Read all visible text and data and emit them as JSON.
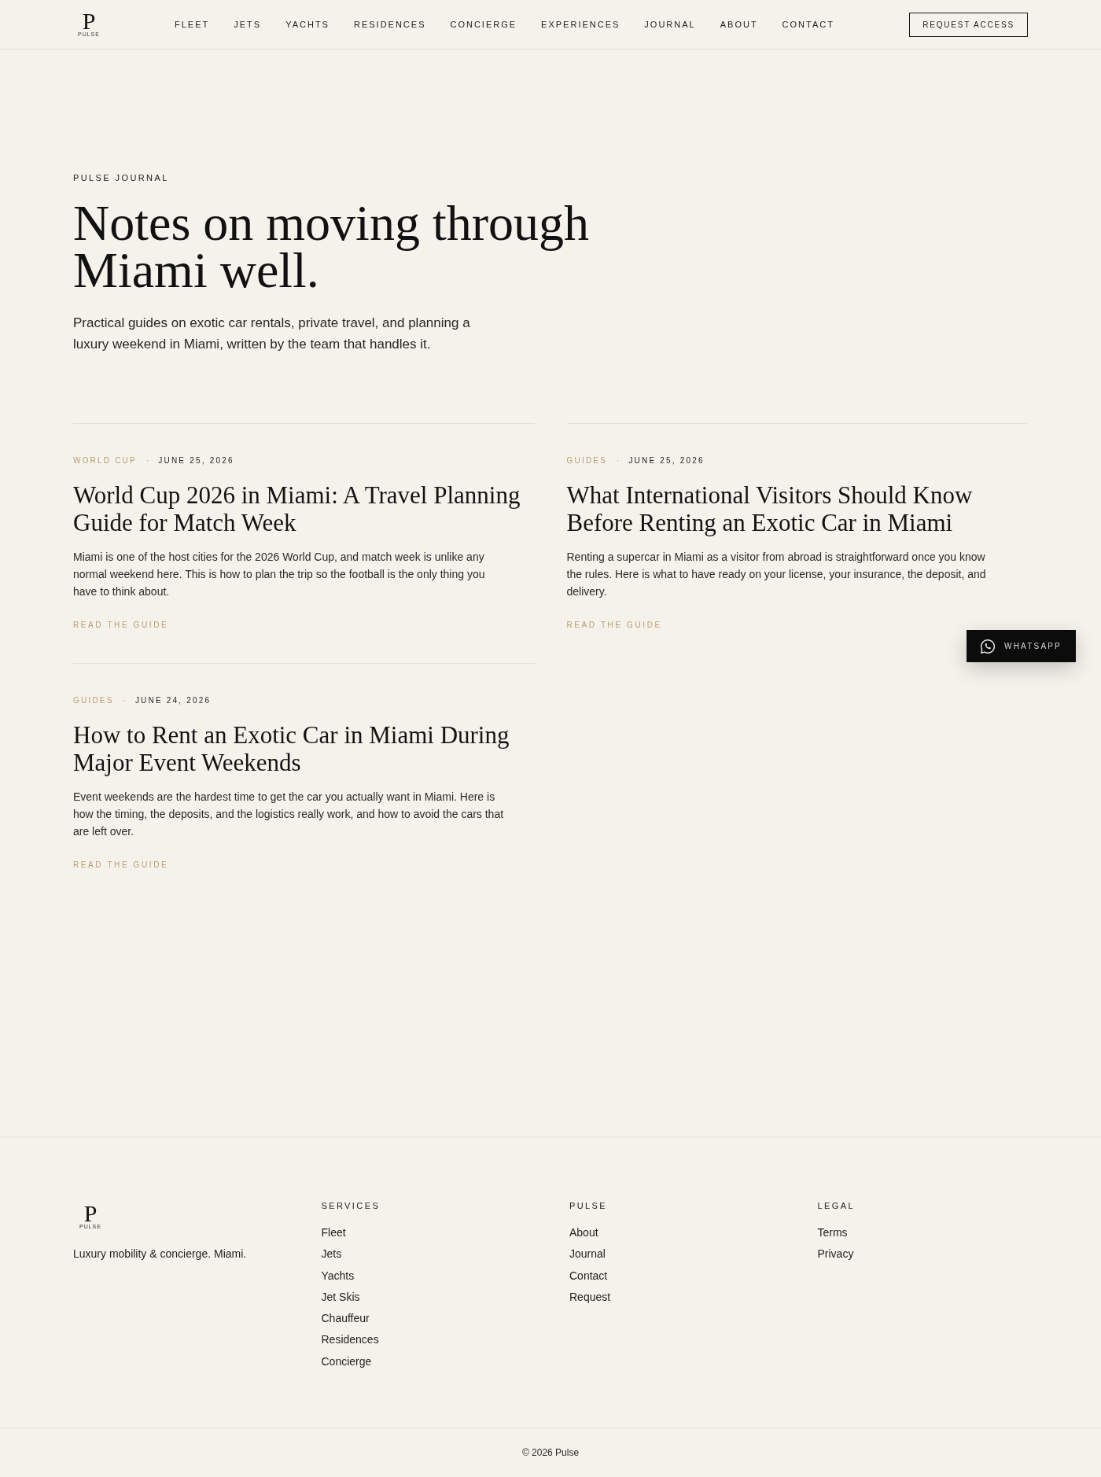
{
  "header": {
    "logo": {
      "letter": "P",
      "wordmark": "PULSE"
    },
    "nav": [
      {
        "label": "FLEET"
      },
      {
        "label": "JETS"
      },
      {
        "label": "YACHTS"
      },
      {
        "label": "RESIDENCES"
      },
      {
        "label": "CONCIERGE"
      },
      {
        "label": "EXPERIENCES"
      },
      {
        "label": "JOURNAL"
      },
      {
        "label": "ABOUT"
      },
      {
        "label": "CONTACT"
      }
    ],
    "cta": "REQUEST ACCESS"
  },
  "hero": {
    "eyebrow": "PULSE JOURNAL",
    "title": "Notes on moving through Miami well.",
    "intro": "Practical guides on exotic car rentals, private travel, and planning a luxury weekend in Miami, written by the team that handles it."
  },
  "articles": [
    {
      "category": "WORLD CUP",
      "separator": "·",
      "date": "JUNE 25, 2026",
      "title": "World Cup 2026 in Miami: A Travel Planning Guide for Match Week",
      "excerpt": "Miami is one of the host cities for the 2026 World Cup, and match week is unlike any normal weekend here. This is how to plan the trip so the football is the only thing you have to think about.",
      "link": "READ THE GUIDE"
    },
    {
      "category": "GUIDES",
      "separator": "·",
      "date": "JUNE 25, 2026",
      "title": "What International Visitors Should Know Before Renting an Exotic Car in Miami",
      "excerpt": "Renting a supercar in Miami as a visitor from abroad is straightforward once you know the rules. Here is what to have ready on your license, your insurance, the deposit, and delivery.",
      "link": "READ THE GUIDE"
    },
    {
      "category": "GUIDES",
      "separator": "·",
      "date": "JUNE 24, 2026",
      "title": "How to Rent an Exotic Car in Miami During Major Event Weekends",
      "excerpt": "Event weekends are the hardest time to get the car you actually want in Miami. Here is how the timing, the deposits, and the logistics really work, and how to avoid the cars that are left over.",
      "link": "READ THE GUIDE"
    }
  ],
  "whatsapp": {
    "label": "WHATSAPP"
  },
  "footer": {
    "logo": {
      "letter": "P",
      "wordmark": "PULSE"
    },
    "tagline": "Luxury mobility & concierge. Miami.",
    "columns": [
      {
        "heading": "SERVICES",
        "links": [
          "Fleet",
          "Jets",
          "Yachts",
          "Jet Skis",
          "Chauffeur",
          "Residences",
          "Concierge"
        ]
      },
      {
        "heading": "PULSE",
        "links": [
          "About",
          "Journal",
          "Contact",
          "Request"
        ]
      },
      {
        "heading": "LEGAL",
        "links": [
          "Terms",
          "Privacy"
        ]
      }
    ],
    "copyright": "© 2026 Pulse"
  }
}
